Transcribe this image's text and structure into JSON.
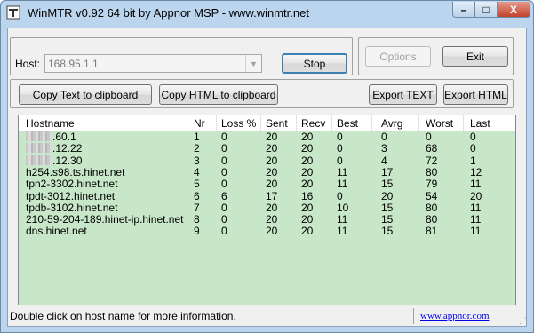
{
  "window": {
    "title": "WinMTR v0.92 64 bit by Appnor MSP - www.winmtr.net"
  },
  "titlebar_buttons": {
    "minimize": "–",
    "maximize": "□",
    "close": "X"
  },
  "host": {
    "label": "Host:",
    "value": "168.95.1.1",
    "arrow": "▼"
  },
  "buttons": {
    "stop": "Stop",
    "options": "Options",
    "exit": "Exit",
    "copy_text": "Copy Text to clipboard",
    "copy_html": "Copy HTML to clipboard",
    "export_text": "Export TEXT",
    "export_html": "Export HTML"
  },
  "table": {
    "columns": [
      "Hostname",
      "Nr",
      "Loss %",
      "Sent",
      "Recv",
      "Best",
      "Avrg",
      "Worst",
      "Last"
    ],
    "rows": [
      {
        "hostname": ".60.1",
        "masked": true,
        "nr": "1",
        "loss": "0",
        "sent": "20",
        "recv": "20",
        "best": "0",
        "avrg": "0",
        "worst": "0",
        "last": "0"
      },
      {
        "hostname": ".12.22",
        "masked": true,
        "nr": "2",
        "loss": "0",
        "sent": "20",
        "recv": "20",
        "best": "0",
        "avrg": "3",
        "worst": "68",
        "last": "0"
      },
      {
        "hostname": ".12.30",
        "masked": true,
        "nr": "3",
        "loss": "0",
        "sent": "20",
        "recv": "20",
        "best": "0",
        "avrg": "4",
        "worst": "72",
        "last": "1"
      },
      {
        "hostname": "h254.s98.ts.hinet.net",
        "masked": false,
        "nr": "4",
        "loss": "0",
        "sent": "20",
        "recv": "20",
        "best": "11",
        "avrg": "17",
        "worst": "80",
        "last": "12"
      },
      {
        "hostname": "tpn2-3302.hinet.net",
        "masked": false,
        "nr": "5",
        "loss": "0",
        "sent": "20",
        "recv": "20",
        "best": "11",
        "avrg": "15",
        "worst": "79",
        "last": "11"
      },
      {
        "hostname": "tpdt-3012.hinet.net",
        "masked": false,
        "nr": "6",
        "loss": "6",
        "sent": "17",
        "recv": "16",
        "best": "0",
        "avrg": "20",
        "worst": "54",
        "last": "20"
      },
      {
        "hostname": "tpdb-3102.hinet.net",
        "masked": false,
        "nr": "7",
        "loss": "0",
        "sent": "20",
        "recv": "20",
        "best": "10",
        "avrg": "15",
        "worst": "80",
        "last": "11"
      },
      {
        "hostname": "210-59-204-189.hinet-ip.hinet.net",
        "masked": false,
        "nr": "8",
        "loss": "0",
        "sent": "20",
        "recv": "20",
        "best": "11",
        "avrg": "15",
        "worst": "80",
        "last": "11"
      },
      {
        "hostname": "dns.hinet.net",
        "masked": false,
        "nr": "9",
        "loss": "0",
        "sent": "20",
        "recv": "20",
        "best": "11",
        "avrg": "15",
        "worst": "81",
        "last": "11"
      }
    ]
  },
  "status": {
    "text": "Double click on host name for more information.",
    "link": "www.appnor.com"
  },
  "colors": {
    "list_bg": "#c8e6c8",
    "frame": "#bcd5ee"
  }
}
